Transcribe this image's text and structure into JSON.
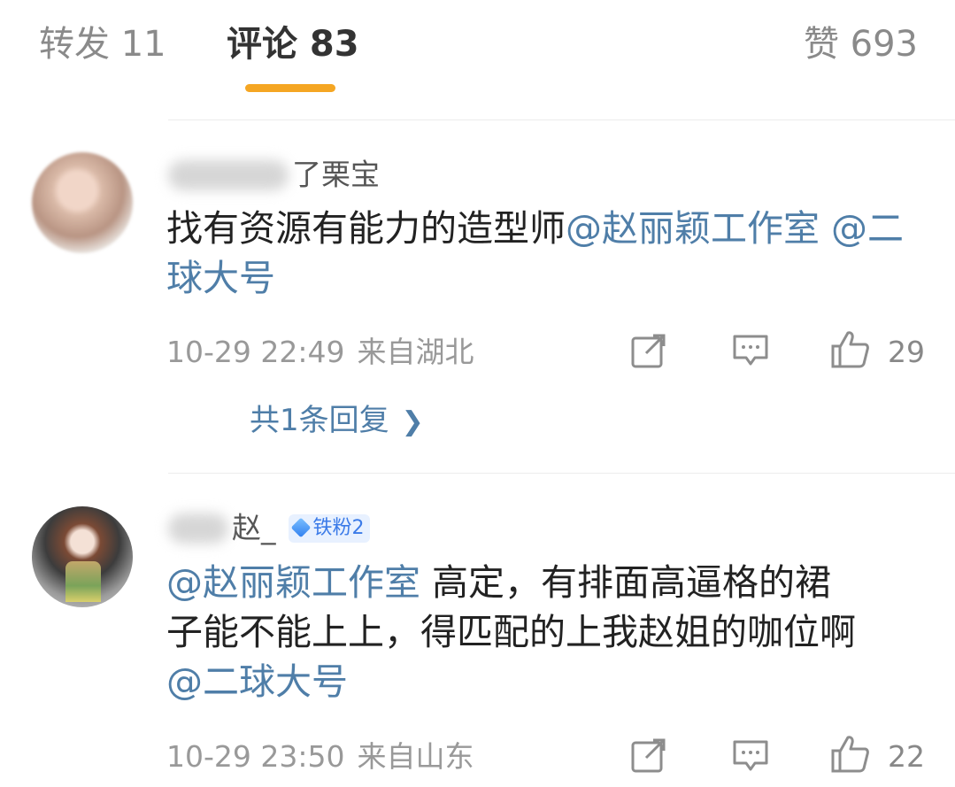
{
  "tabs": {
    "repost": "转发 11",
    "comments": "评论 83",
    "likes": "赞 693"
  },
  "colors": {
    "accent": "#f5a623",
    "mention": "#4f7ea8",
    "badge_bg": "#e8f1ff",
    "badge_text": "#3b7be8"
  },
  "comments": [
    {
      "username_visible": "了栗宝",
      "text_plain_1": "找有资源有能力的造型师",
      "mention_1": "@赵丽颖工作室",
      "mention_2": "@二球大号",
      "time": "10-29 22:49",
      "location": "来自湖北",
      "likes": "29",
      "replies_link": "共1条回复",
      "icons": [
        "share-icon",
        "comment-icon",
        "like-icon"
      ]
    },
    {
      "username_visible": "赵_",
      "badge": "铁粉2",
      "mention_1": "@赵丽颖工作室",
      "text_plain_1": " 高定，有排面高逼格的裙",
      "text_plain_2": "子能不能上上，得匹配的上我赵姐的咖位啊",
      "mention_2": "@二球大号",
      "time": "10-29 23:50",
      "location": "来自山东",
      "likes": "22",
      "icons": [
        "share-icon",
        "comment-icon",
        "like-icon"
      ]
    }
  ]
}
